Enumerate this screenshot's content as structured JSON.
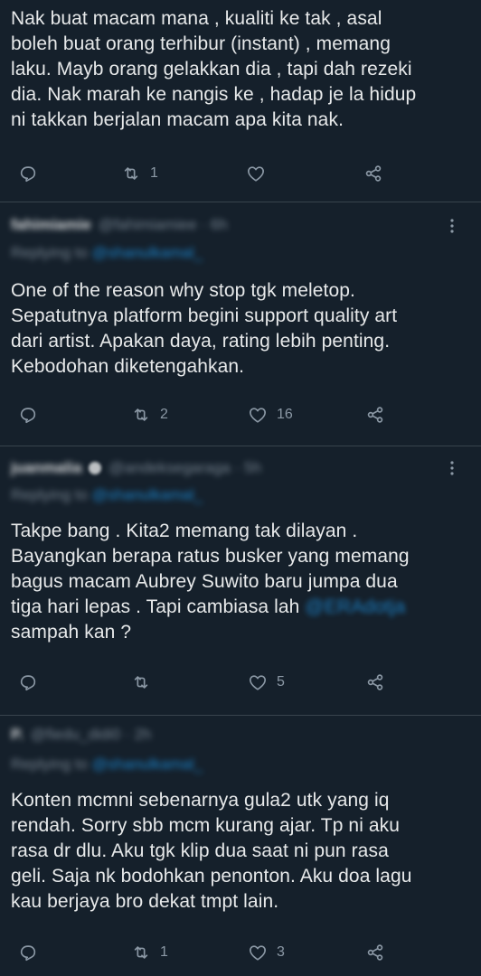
{
  "tweets": [
    {
      "lines": [
        "Nak buat macam mana , kualiti ke tak , asal",
        "boleh buat orang terhibur (instant) , memang",
        "laku. Mayb orang gelakkan dia , tapi dah rezeki",
        "dia. Nak marah ke nangis ke , hadap je la hidup",
        "ni takkan berjalan macam apa kita nak."
      ],
      "retweets": "1",
      "likes": ""
    },
    {
      "username": "fahimiamie",
      "handle": "@fahimiamiee · 6h",
      "replying_label": "Replying to",
      "replying_user": "@shanulkamal_",
      "lines": [
        "One of the reason why stop tgk meletop.",
        "Sepatutnya platform begini support quality art",
        "dari artist. Apakan daya, rating lebih penting.",
        "Kebodohan diketengahkan."
      ],
      "retweets": "2",
      "likes": "16"
    },
    {
      "username": "juanmalia",
      "handle": "@andeksegaraga · 5h",
      "replying_label": "Replying to",
      "replying_user": "@shanulkamal_",
      "lines": [
        "Takpe bang . Kita2 memang tak dilayan .",
        "Bayangkan berapa ratus busker yang memang",
        "bagus macam Aubrey Suwito baru jumpa dua",
        "tiga hari lepas . Tapi cambiasa lah",
        "sampah kan ?"
      ],
      "mention": "@ERAdotja",
      "retweets": "",
      "likes": "5"
    },
    {
      "username": "P.",
      "handle": "@fiedu_didi0 · 2h",
      "replying_label": "Replying to",
      "replying_user": "@shanulkamal_",
      "lines": [
        "Konten mcmni sebenarnya gula2 utk yang iq",
        "rendah. Sorry sbb mcm kurang ajar. Tp ni aku",
        "rasa dr dlu. Aku tgk klip dua saat ni pun rasa",
        "geli. Saja nk bodohkan penonton. Aku doa lagu",
        "kau berjaya bro dekat tmpt lain."
      ],
      "retweets": "1",
      "likes": "3"
    }
  ],
  "icons": {
    "reply": "reply-icon",
    "retweet": "retweet-icon",
    "like": "heart-icon",
    "share": "share-icon",
    "more": "more-icon"
  },
  "colors": {
    "background": "#15202b",
    "text": "#e7e9ea",
    "muted": "#8b98a5",
    "accent": "#1d9bf0",
    "divider": "#38444d"
  }
}
